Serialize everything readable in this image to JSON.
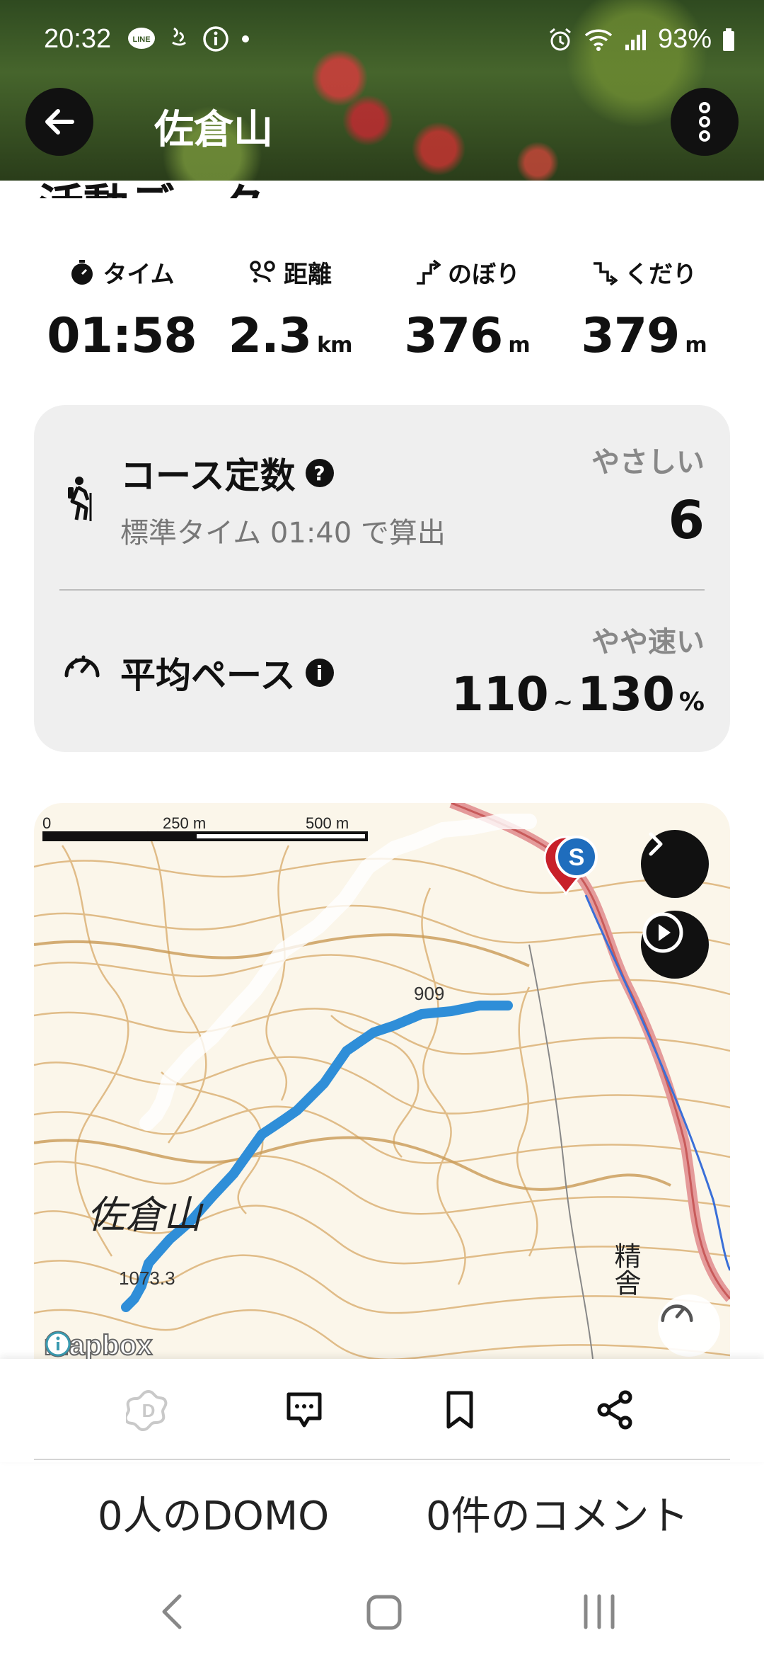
{
  "status_bar": {
    "time": "20:32",
    "battery": "93%",
    "icons": [
      "line-icon",
      "digital-wellbeing-icon",
      "info-icon",
      "dot-icon",
      "alarm-icon",
      "wifi-icon",
      "signal-icon",
      "battery-icon"
    ]
  },
  "header": {
    "title": "佐倉山"
  },
  "section_title_partial": "活動データ",
  "stats": [
    {
      "label": "タイム",
      "value": "01:58",
      "unit": "",
      "icon": "timer-icon"
    },
    {
      "label": "距離",
      "value": "2.3",
      "unit": "km",
      "icon": "route-icon"
    },
    {
      "label": "のぼり",
      "value": "376",
      "unit": "m",
      "icon": "ascent-icon"
    },
    {
      "label": "くだり",
      "value": "379",
      "unit": "m",
      "icon": "descent-icon"
    }
  ],
  "course": {
    "title": "コース定数",
    "subtitle": "標準タイム 01:40 で算出",
    "difficulty": "やさしい",
    "value": "6",
    "help_symbol": "?"
  },
  "pace": {
    "title": "平均ペース",
    "level": "やや速い",
    "min": "110",
    "tilde": "~",
    "max": "130",
    "unit": "%",
    "info_symbol": "i"
  },
  "map": {
    "scale_labels": [
      "0",
      "250 m",
      "500 m"
    ],
    "contour_label_1": "909",
    "summit_label": "1073.3",
    "place_name": "佐倉山",
    "temple_name": "精舎",
    "start_marker": "S",
    "attribution": "mapbox"
  },
  "actions": {
    "icons": [
      "domo-icon",
      "comment-icon",
      "bookmark-icon",
      "share-icon"
    ],
    "domo_count_text": "0人のDOMO",
    "comment_count_text": "0件のコメント"
  }
}
